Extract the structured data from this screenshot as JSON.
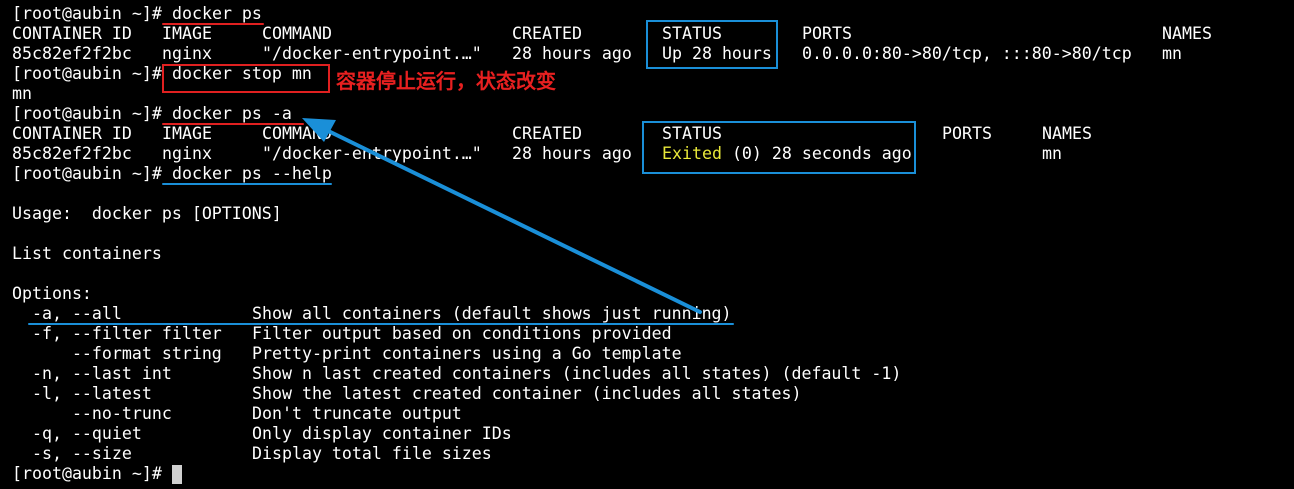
{
  "terminal": {
    "line0": {
      "prompt": "[root@aubin ~]# ",
      "cmd": "docker ps"
    },
    "line1": {
      "container_id": "CONTAINER ID",
      "image": "IMAGE",
      "command": "COMMAND",
      "created": "CREATED",
      "status": "STATUS",
      "ports": "PORTS",
      "names": "NAMES"
    },
    "line2": {
      "container_id": "85c82ef2f2bc",
      "image": "nginx",
      "command": "\"/docker-entrypoint.…\"",
      "created": "28 hours ago",
      "status": "Up 28 hours",
      "ports": "0.0.0.0:80->80/tcp, :::80->80/tcp",
      "names": "mn"
    },
    "line3": {
      "prompt": "[root@aubin ~]# ",
      "cmd": "docker stop mn"
    },
    "line4": {
      "text": "mn"
    },
    "line5": {
      "prompt": "[root@aubin ~]# ",
      "cmd": "docker ps -a"
    },
    "line6": {
      "container_id": "CONTAINER ID",
      "image": "IMAGE",
      "command": "COMMAND",
      "created": "CREATED",
      "status": "STATUS",
      "ports": "PORTS",
      "names": "NAMES"
    },
    "line7": {
      "container_id": "85c82ef2f2bc",
      "image": "nginx",
      "command": "\"/docker-entrypoint.…\"",
      "created": "28 hours ago",
      "status_word": "Exited",
      "status_rest": " (0) 28 seconds ago",
      "names": "mn"
    },
    "line8": {
      "prompt": "[root@aubin ~]# ",
      "cmd": "docker ps --help"
    },
    "line10": {
      "text": "Usage:  docker ps [OPTIONS]"
    },
    "line12": {
      "text": "List containers"
    },
    "line14": {
      "text": "Options:"
    },
    "options": [
      {
        "flag": "  -a, --all",
        "desc": "Show all containers (default shows just running)"
      },
      {
        "flag": "  -f, --filter filter",
        "desc": "Filter output based on conditions provided"
      },
      {
        "flag": "      --format string",
        "desc": "Pretty-print containers using a Go template"
      },
      {
        "flag": "  -n, --last int",
        "desc": "Show n last created containers (includes all states) (default -1)"
      },
      {
        "flag": "  -l, --latest",
        "desc": "Show the latest created container (includes all states)"
      },
      {
        "flag": "      --no-trunc",
        "desc": "Don't truncate output"
      },
      {
        "flag": "  -q, --quiet",
        "desc": "Only display container IDs"
      },
      {
        "flag": "  -s, --size",
        "desc": "Display total file sizes"
      }
    ],
    "line23": {
      "prompt": "[root@aubin ~]# "
    }
  },
  "annotation": {
    "text": "容器停止运行，状态改变"
  },
  "colors": {
    "background": "#000000",
    "foreground": "#ffffff",
    "exited": "#e8e83a",
    "red": "#e02020",
    "blue": "#1a8fd8"
  }
}
